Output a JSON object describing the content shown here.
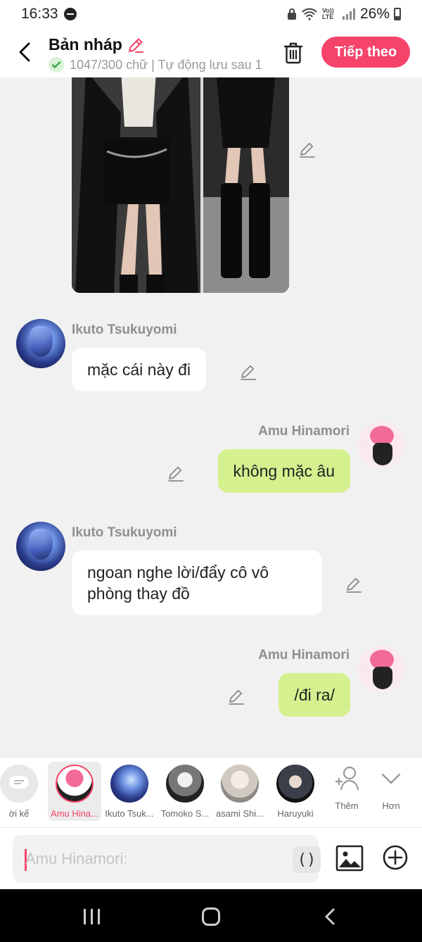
{
  "status_bar": {
    "time": "16:33",
    "battery": "26%",
    "volte": "Vo)) LTE"
  },
  "header": {
    "title": "Bản nháp",
    "subtitle": "1047/300 chữ | Tự động lưu sau 1",
    "next_label": "Tiếp theo"
  },
  "chat": {
    "messages": [
      {
        "speaker": "Ikuto Tsukuyomi",
        "side": "left",
        "text": "mặc cái này đi"
      },
      {
        "speaker": "Amu Hinamori",
        "side": "right",
        "text": "không mặc âu"
      },
      {
        "speaker": "Ikuto Tsukuyomi",
        "side": "left",
        "text": "ngoan nghe lời/đẩy cô vô phòng thay đồ"
      },
      {
        "speaker": "Amu Hinamori",
        "side": "right",
        "text": "/đi ra/"
      }
    ]
  },
  "characters": {
    "items": [
      {
        "label": "ời kể"
      },
      {
        "label": "Amu Hina...",
        "selected": true
      },
      {
        "label": "Ikuto Tsuk..."
      },
      {
        "label": "Tomoko S..."
      },
      {
        "label": "asami Shi..."
      },
      {
        "label": "Haruyuki"
      }
    ],
    "more_label": "Thêm",
    "expand_label": "Hơn"
  },
  "composer": {
    "placeholder": "Amu Hinamori:",
    "paren_label": "()"
  },
  "colors": {
    "accent": "#f5436a",
    "user_bubble": "#d5f18f",
    "other_bubble": "#ffffff",
    "chat_bg": "#f1f1f1"
  }
}
